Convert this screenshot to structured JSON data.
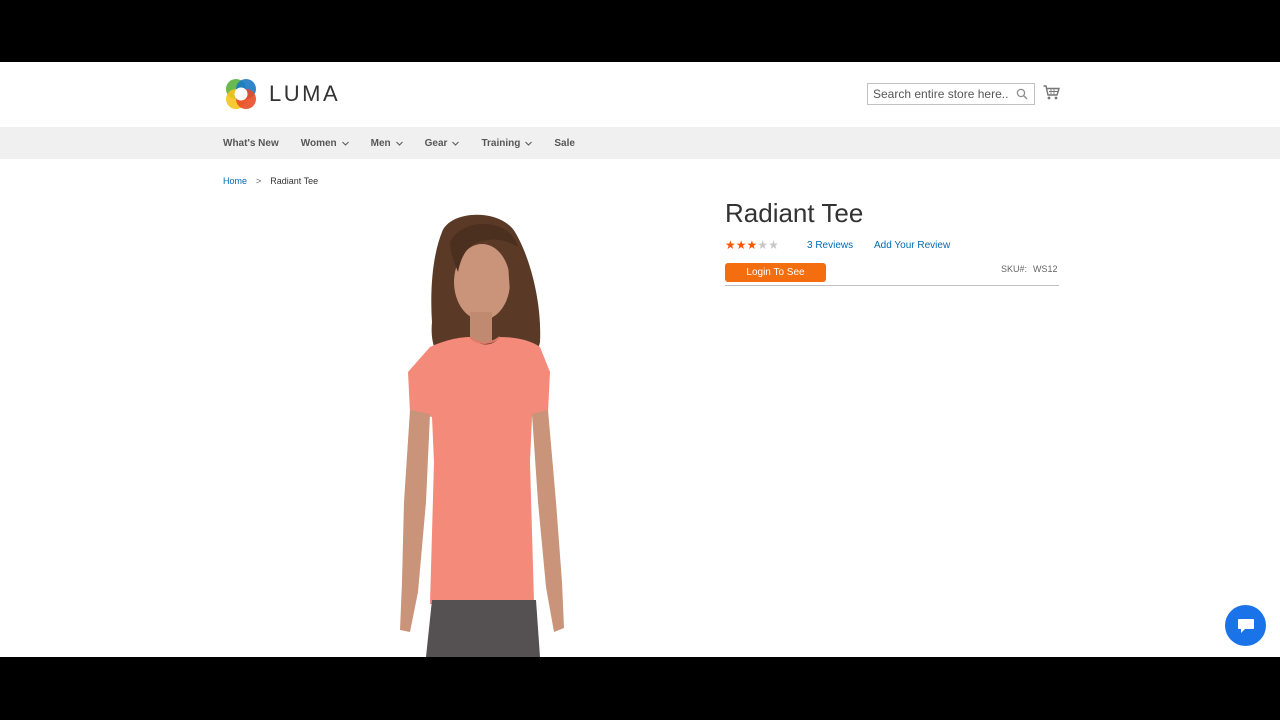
{
  "header": {
    "logo_text": "LUMA",
    "search_placeholder": "Search entire store here...",
    "search_icon": "search-icon",
    "cart_icon": "cart-icon"
  },
  "nav": {
    "items": [
      {
        "label": "What's New",
        "has_dropdown": false
      },
      {
        "label": "Women",
        "has_dropdown": true
      },
      {
        "label": "Men",
        "has_dropdown": true
      },
      {
        "label": "Gear",
        "has_dropdown": true
      },
      {
        "label": "Training",
        "has_dropdown": true
      },
      {
        "label": "Sale",
        "has_dropdown": false
      }
    ]
  },
  "breadcrumb": {
    "home": "Home",
    "separator": ">",
    "current": "Radiant Tee"
  },
  "product": {
    "title": "Radiant Tee",
    "rating_stars": 3,
    "rating_max": 5,
    "reviews_label": "3 Reviews",
    "add_review_label": "Add Your Review",
    "login_button_label": "Login To See",
    "sku_label": "SKU#:",
    "sku_value": "WS12"
  },
  "chat": {
    "icon": "chat-icon"
  },
  "colors": {
    "accent_orange": "#f46d0e",
    "link_blue": "#006bb4",
    "star_orange": "#ff5501",
    "nav_bg": "#f0f0f0",
    "chat_blue": "#1a73e8"
  }
}
